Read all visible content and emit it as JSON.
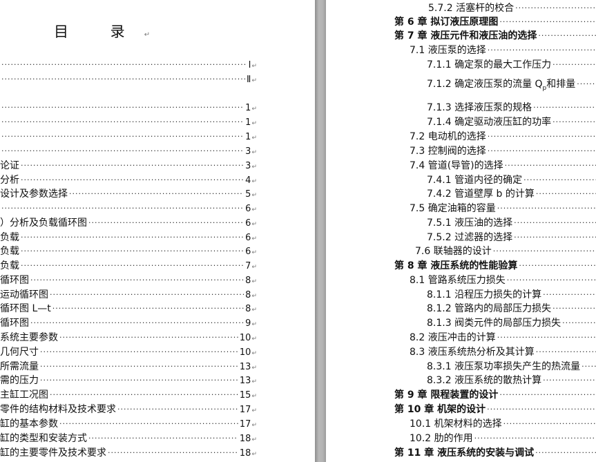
{
  "left_page": {
    "title": "目 录",
    "paragraph_mark": "↵",
    "entries": [
      {
        "label": "",
        "page": "Ⅰ"
      },
      {
        "label": "",
        "page": "Ⅱ"
      },
      {
        "label": "",
        "page": "1"
      },
      {
        "label": "",
        "page": "1"
      },
      {
        "label": "",
        "page": "1"
      },
      {
        "label": "",
        "page": "3"
      },
      {
        "label": "论证",
        "page": "3"
      },
      {
        "label": "分析",
        "page": "4"
      },
      {
        "label": "设计及参数选择",
        "page": "5"
      },
      {
        "label": "",
        "page": "6"
      },
      {
        "label": "）分析及负载循环图",
        "page": "6"
      },
      {
        "label": "负载",
        "page": "6"
      },
      {
        "label": "负载",
        "page": "6"
      },
      {
        "label": "负载",
        "page": "7"
      },
      {
        "label": "循环图",
        "page": "8"
      },
      {
        "label": "运动循环图",
        "page": "8"
      },
      {
        "label": "循环图 L—t",
        "page": "8"
      },
      {
        "label": "循环图",
        "page": "9"
      },
      {
        "label": "系统主要参数",
        "page": "10"
      },
      {
        "label": "几何尺寸",
        "page": "10"
      },
      {
        "label": "所需流量",
        "page": "13"
      },
      {
        "label": "需的压力",
        "page": "13"
      },
      {
        "label": "主缸工况图",
        "page": "15"
      },
      {
        "label": "零件的结构材料及技术要求",
        "page": "17"
      },
      {
        "label": "缸的基本参数",
        "page": "17"
      },
      {
        "label": "缸的类型和安装方式",
        "page": "18"
      },
      {
        "label": "缸的主要零件及技术要求",
        "page": "18"
      }
    ]
  },
  "right_page": {
    "entries": [
      {
        "label": "5.7.2 活塞杆的校合",
        "bold": false
      },
      {
        "label": "第 6 章   拟订液压原理图",
        "bold": true
      },
      {
        "label": "第 7 章   液压元件和液压油的选择",
        "bold": true
      },
      {
        "label": "7.1 液压泵的选择",
        "bold": false
      },
      {
        "label": "7.1.1 确定泵的最大工作压力",
        "bold": false
      },
      {
        "label": "7.1.2 确定液压泵的流量 Q",
        "subscript": "p",
        "suffix": "和排量",
        "bold": false
      },
      {
        "label": "7.1.3 选择液压泵的规格",
        "bold": false
      },
      {
        "label": "7.1.4 确定驱动液压缸的功率",
        "bold": false
      },
      {
        "label": "7.2 电动机的选择",
        "bold": false
      },
      {
        "label": "7.3 控制阀的选择",
        "bold": false
      },
      {
        "label": "7.4 管道(导管)的选择",
        "bold": false
      },
      {
        "label": "7.4.1 管道内径的确定",
        "bold": false
      },
      {
        "label": "7.4.2 管道壁厚 b 的计算",
        "bold": false
      },
      {
        "label": "7.5 确定油箱的容量",
        "bold": false
      },
      {
        "label": "7.5.1 液压油的选择",
        "bold": false
      },
      {
        "label": "7.5.2 过滤器的选择",
        "bold": false
      },
      {
        "label": "7.6 联轴器的设计",
        "bold": false
      },
      {
        "label": "第 8 章   液压系统的性能验算",
        "bold": true
      },
      {
        "label": "8.1 管路系统压力损失",
        "bold": false
      },
      {
        "label": "8.1.1 沿程压力损失的计算",
        "bold": false
      },
      {
        "label": "8.1.2 管路内的局部压力损失",
        "bold": false
      },
      {
        "label": "8.1.3 阀类元件的局部压力损失",
        "bold": false
      },
      {
        "label": "8.2 液压冲击的计算",
        "bold": false
      },
      {
        "label": "8.3 液压系统热分析及其计算",
        "bold": false
      },
      {
        "label": "8.3.1 液压泵功率损失产生的热流量",
        "bold": false
      },
      {
        "label": "8.3.2 液压系统的散热计算",
        "bold": false
      },
      {
        "label": "第 9 章   限程装置的设计",
        "bold": true
      },
      {
        "label": "第 10 章   机架的设计",
        "bold": true
      },
      {
        "label": "10.1 机架材料的选择",
        "bold": false
      },
      {
        "label": "10.2 肋的作用",
        "bold": false
      },
      {
        "label": "第 11 章   液压系统的安装与调试",
        "bold": true
      }
    ]
  }
}
